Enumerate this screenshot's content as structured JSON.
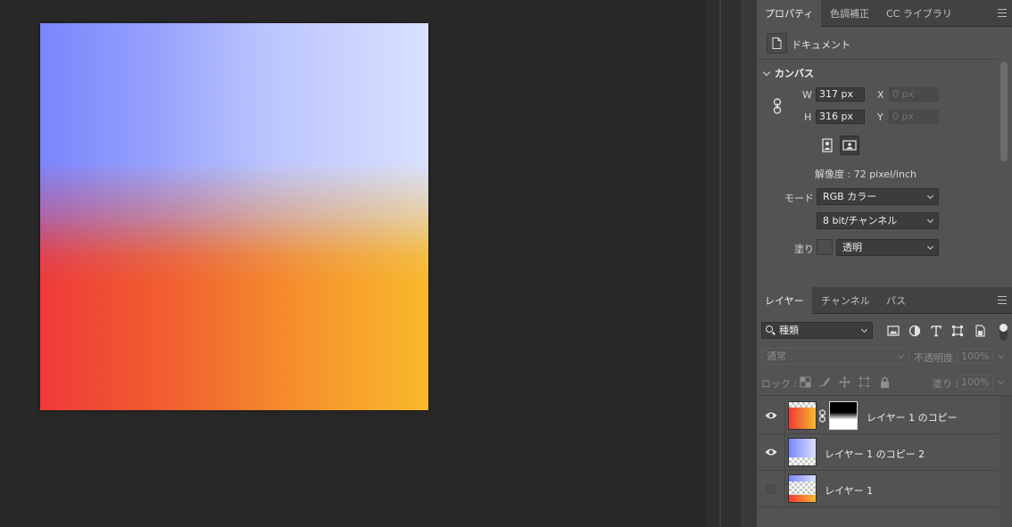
{
  "props_panel": {
    "tabs": [
      "プロパティ",
      "色調補正",
      "CC ライブラリ"
    ],
    "doc_label": "ドキュメント",
    "section": "カンバス",
    "width_label": "W",
    "width_value": "317 px",
    "height_label": "H",
    "height_value": "316 px",
    "x_label": "X",
    "x_placeholder": "0 px",
    "y_label": "Y",
    "y_placeholder": "0 px",
    "resolution": "解像度 : 72 pixel/inch",
    "mode_label": "モード",
    "mode_value": "RGB カラー",
    "bit_value": "8 bit/チャンネル",
    "fill_label": "塗り",
    "fill_value": "透明"
  },
  "layers_panel": {
    "tabs": [
      "レイヤー",
      "チャンネル",
      "パス"
    ],
    "filter_value": "種類",
    "blend_mode": "通常",
    "opacity_label": "不透明度 :",
    "opacity_value": "100%",
    "lock_label": "ロック :",
    "fill_label": "塗り :",
    "fill_value": "100%",
    "layers": [
      {
        "name": "レイヤー 1 のコピー",
        "visible": true,
        "has_mask": true
      },
      {
        "name": "レイヤー 1 のコピー 2",
        "visible": true,
        "has_mask": false
      },
      {
        "name": "レイヤー 1",
        "visible": false,
        "has_mask": false
      }
    ]
  },
  "colors": {
    "gradient_bottom": [
      "#ef3a39",
      "#f9b92c"
    ],
    "gradient_top": [
      "#7a85fd",
      "#d9e1fe"
    ]
  }
}
